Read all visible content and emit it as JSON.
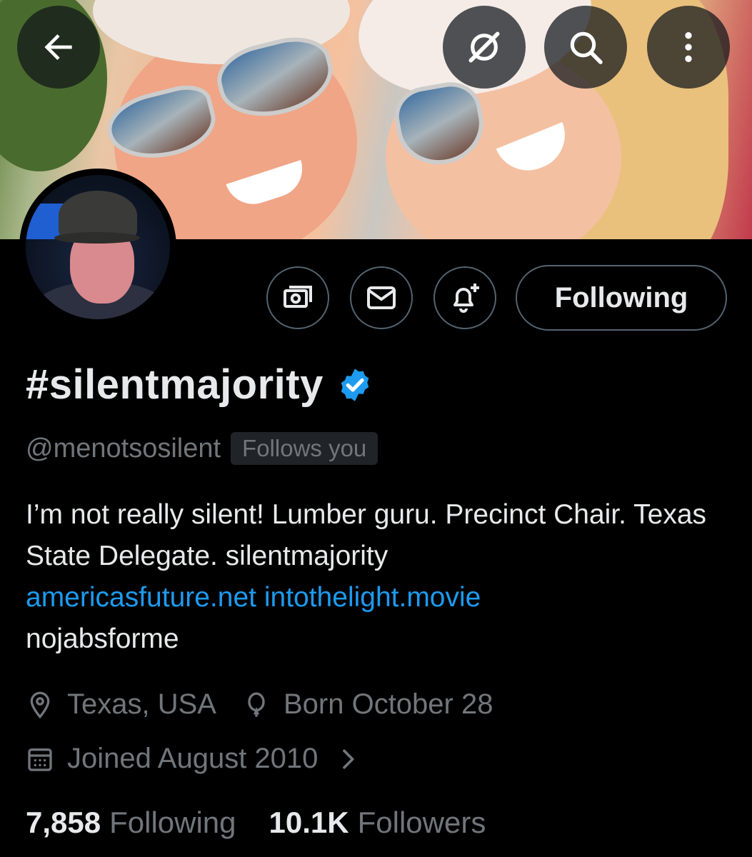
{
  "header": {
    "back_icon": "arrow-left-icon",
    "grok_icon": "grok-icon",
    "search_icon": "search-icon",
    "more_icon": "more-vertical-icon"
  },
  "actions": {
    "tip_icon": "money-icon",
    "message_icon": "envelope-icon",
    "notify_icon": "bell-plus-icon",
    "following_label": "Following"
  },
  "profile": {
    "display_name": "#silentmajority",
    "verified": true,
    "handle": "@menotsosilent",
    "follows_you": "Follows you",
    "bio_text": "I’m not really silent! Lumber guru. Precinct Chair. Texas State Delegate. silentmajority",
    "bio_link1": "americasfuture.net",
    "bio_link2": "intothelight.movie",
    "bio_tail": "nojabsforme",
    "location": "Texas, USA",
    "birthday": "Born October 28",
    "joined": "Joined August 2010"
  },
  "stats": {
    "following_count": "7,858",
    "following_label": "Following",
    "followers_count": "10.1K",
    "followers_label": "Followers"
  },
  "colors": {
    "background": "#000000",
    "text": "#e7e9ea",
    "muted": "#71767b",
    "link": "#1d9bf0",
    "verified": "#1d9bf0"
  }
}
